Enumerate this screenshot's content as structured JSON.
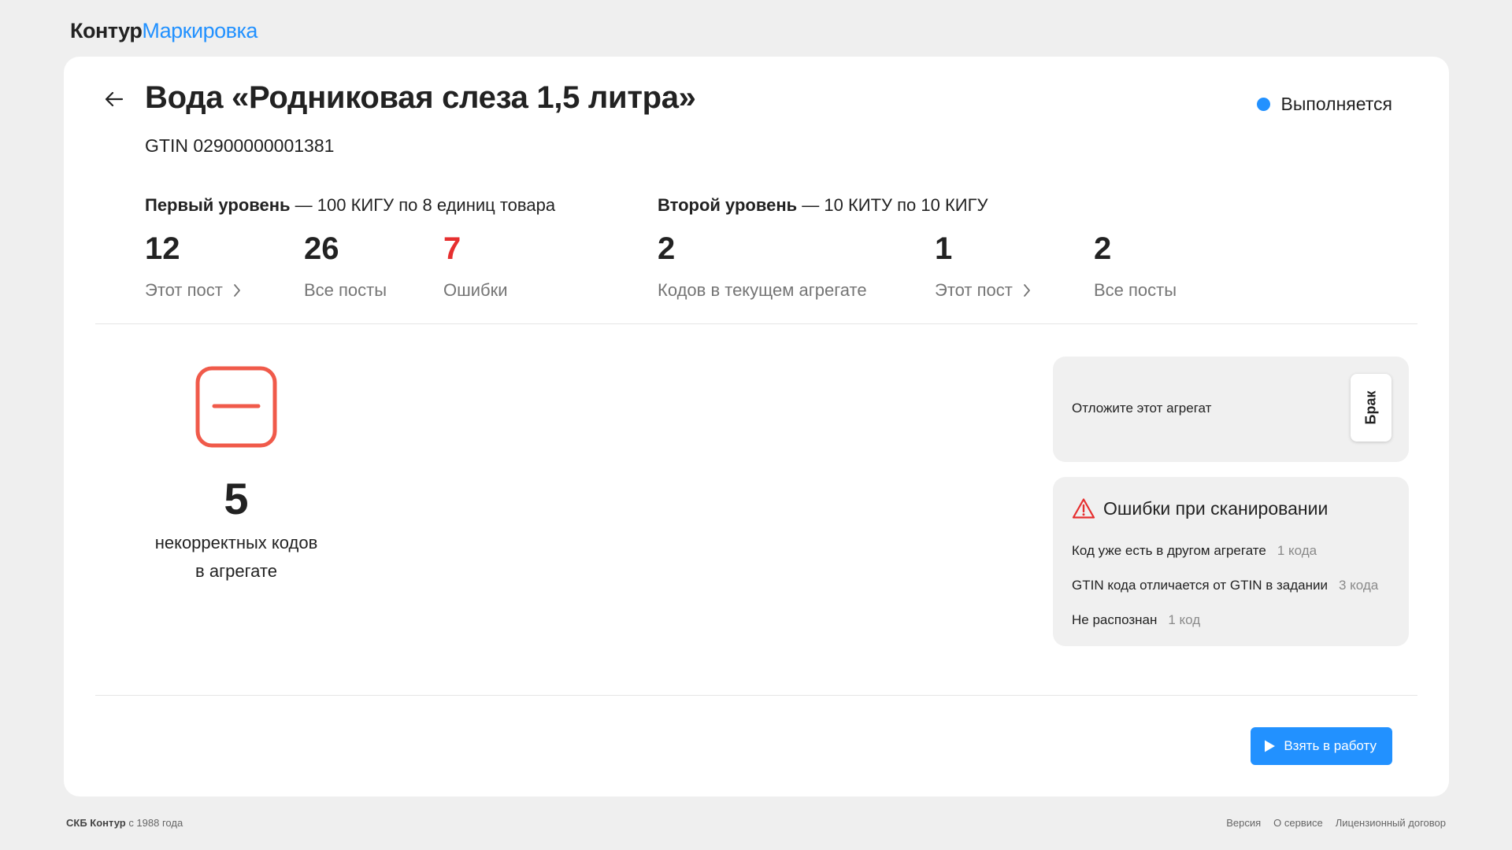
{
  "brand": {
    "part1": "Контур",
    "part2": "Маркировка"
  },
  "header": {
    "title": "Вода «Родниковая слеза 1,5 литра»",
    "gtin": "GTIN 02900000001381",
    "status": "Выполняется",
    "status_color": "#2291ff"
  },
  "level1": {
    "name": "Первый уровень",
    "desc": " — 100 КИГУ по 8 единиц товара",
    "stats": [
      {
        "value": "12",
        "label": "Этот пост"
      },
      {
        "value": "26",
        "label": "Все посты"
      },
      {
        "value": "7",
        "label": "Ошибки"
      }
    ]
  },
  "level2": {
    "name": "Второй уровень",
    "desc": " — 10 КИТУ по 10 КИГУ",
    "stats": [
      {
        "value": "2",
        "label": "Кодов в текущем агрегате"
      },
      {
        "value": "1",
        "label": "Этот пост"
      },
      {
        "value": "2",
        "label": "Все посты"
      }
    ]
  },
  "aggregate": {
    "count": "5",
    "text_line1": "некорректных кодов",
    "text_line2": "в агрегате",
    "icon": "minus-square-icon",
    "icon_color": "#f05a4a"
  },
  "defer_panel": {
    "text": "Отложите этот агрегат",
    "button": "Брак"
  },
  "errors_panel": {
    "title": "Ошибки при сканировании",
    "icon": "warning-triangle-icon",
    "icon_color": "#e62f2f",
    "rows": [
      {
        "label": "Код уже есть в другом агрегате",
        "count": "1 кода"
      },
      {
        "label": "GTIN кода отличается от GTIN в задании",
        "count": "3 кода"
      },
      {
        "label": "Не распознан",
        "count": "1 код"
      }
    ]
  },
  "actions": {
    "start": "Взять в работу",
    "accent": "#2291ff"
  },
  "footer": {
    "company": "СКБ Контур",
    "since": " с 1988 года",
    "links": [
      "Версия",
      "О сервисе",
      "Лицензионный договор"
    ]
  }
}
